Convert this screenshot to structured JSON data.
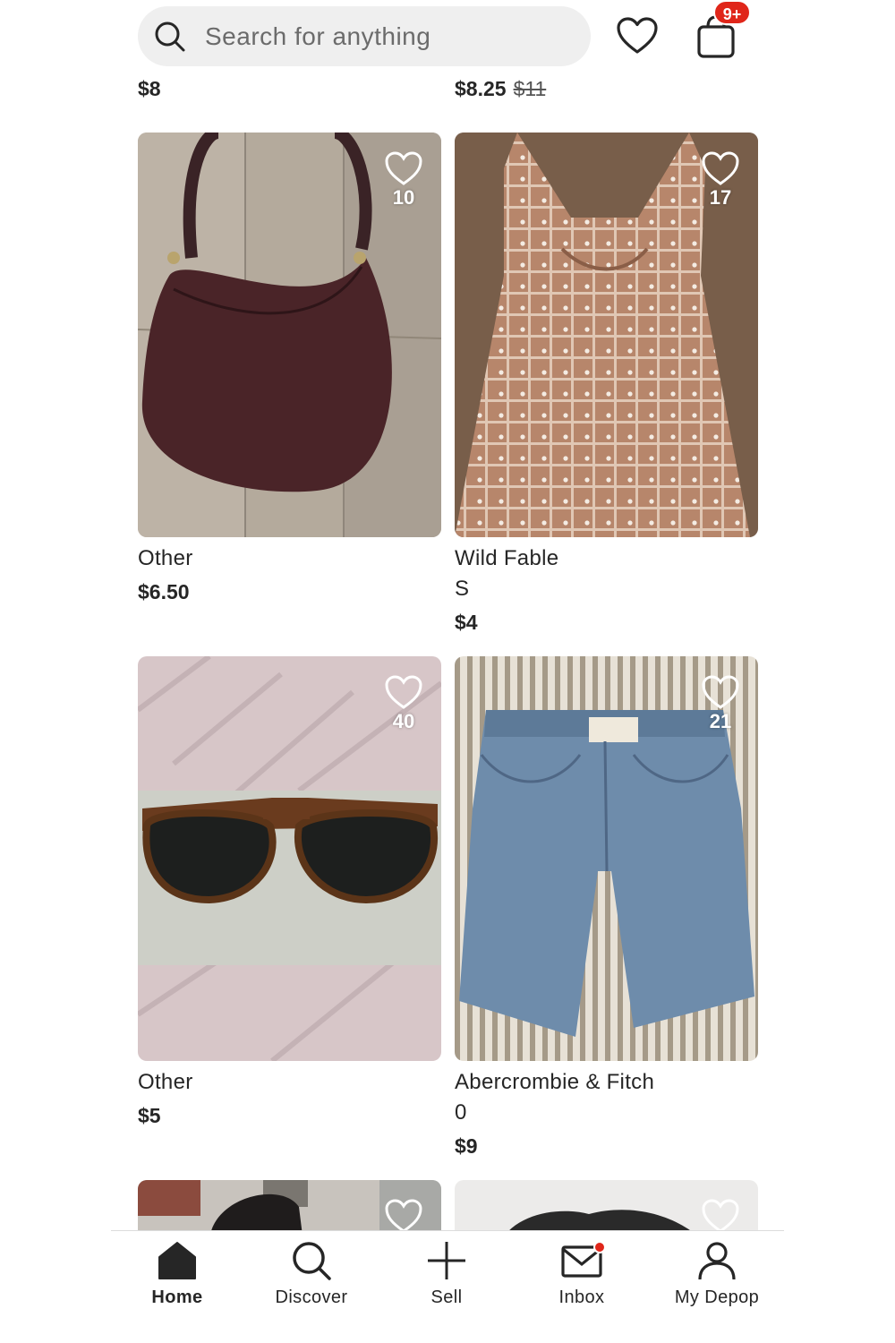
{
  "header": {
    "search_placeholder": "Search for anything",
    "cart_badge": "9+"
  },
  "partial_row": {
    "left_price": "$8",
    "right_price": "$8.25",
    "right_original_price": "$11"
  },
  "products": [
    {
      "brand": "Other",
      "size": "",
      "price": "$6.50",
      "likes": "10",
      "image": "brown-leather-shoulder-bag"
    },
    {
      "brand": "Wild Fable",
      "size": "S",
      "price": "$4",
      "likes": "17",
      "image": "plaid-polka-dot-dress"
    },
    {
      "brand": "Other",
      "size": "",
      "price": "$5",
      "likes": "40",
      "image": "tortoiseshell-sunglasses"
    },
    {
      "brand": "Abercrombie & Fitch",
      "size": "0",
      "price": "$9",
      "likes": "21",
      "image": "denim-cutoff-shorts"
    }
  ],
  "nav": {
    "items": [
      {
        "label": "Home",
        "icon": "home-icon",
        "active": true
      },
      {
        "label": "Discover",
        "icon": "search-icon",
        "active": false
      },
      {
        "label": "Sell",
        "icon": "plus-icon",
        "active": false
      },
      {
        "label": "Inbox",
        "icon": "mail-icon",
        "active": false
      },
      {
        "label": "My Depop",
        "icon": "person-icon",
        "active": false
      }
    ]
  },
  "colors": {
    "badge": "#e0261a",
    "text": "#262626",
    "search_bg": "#efefef"
  }
}
